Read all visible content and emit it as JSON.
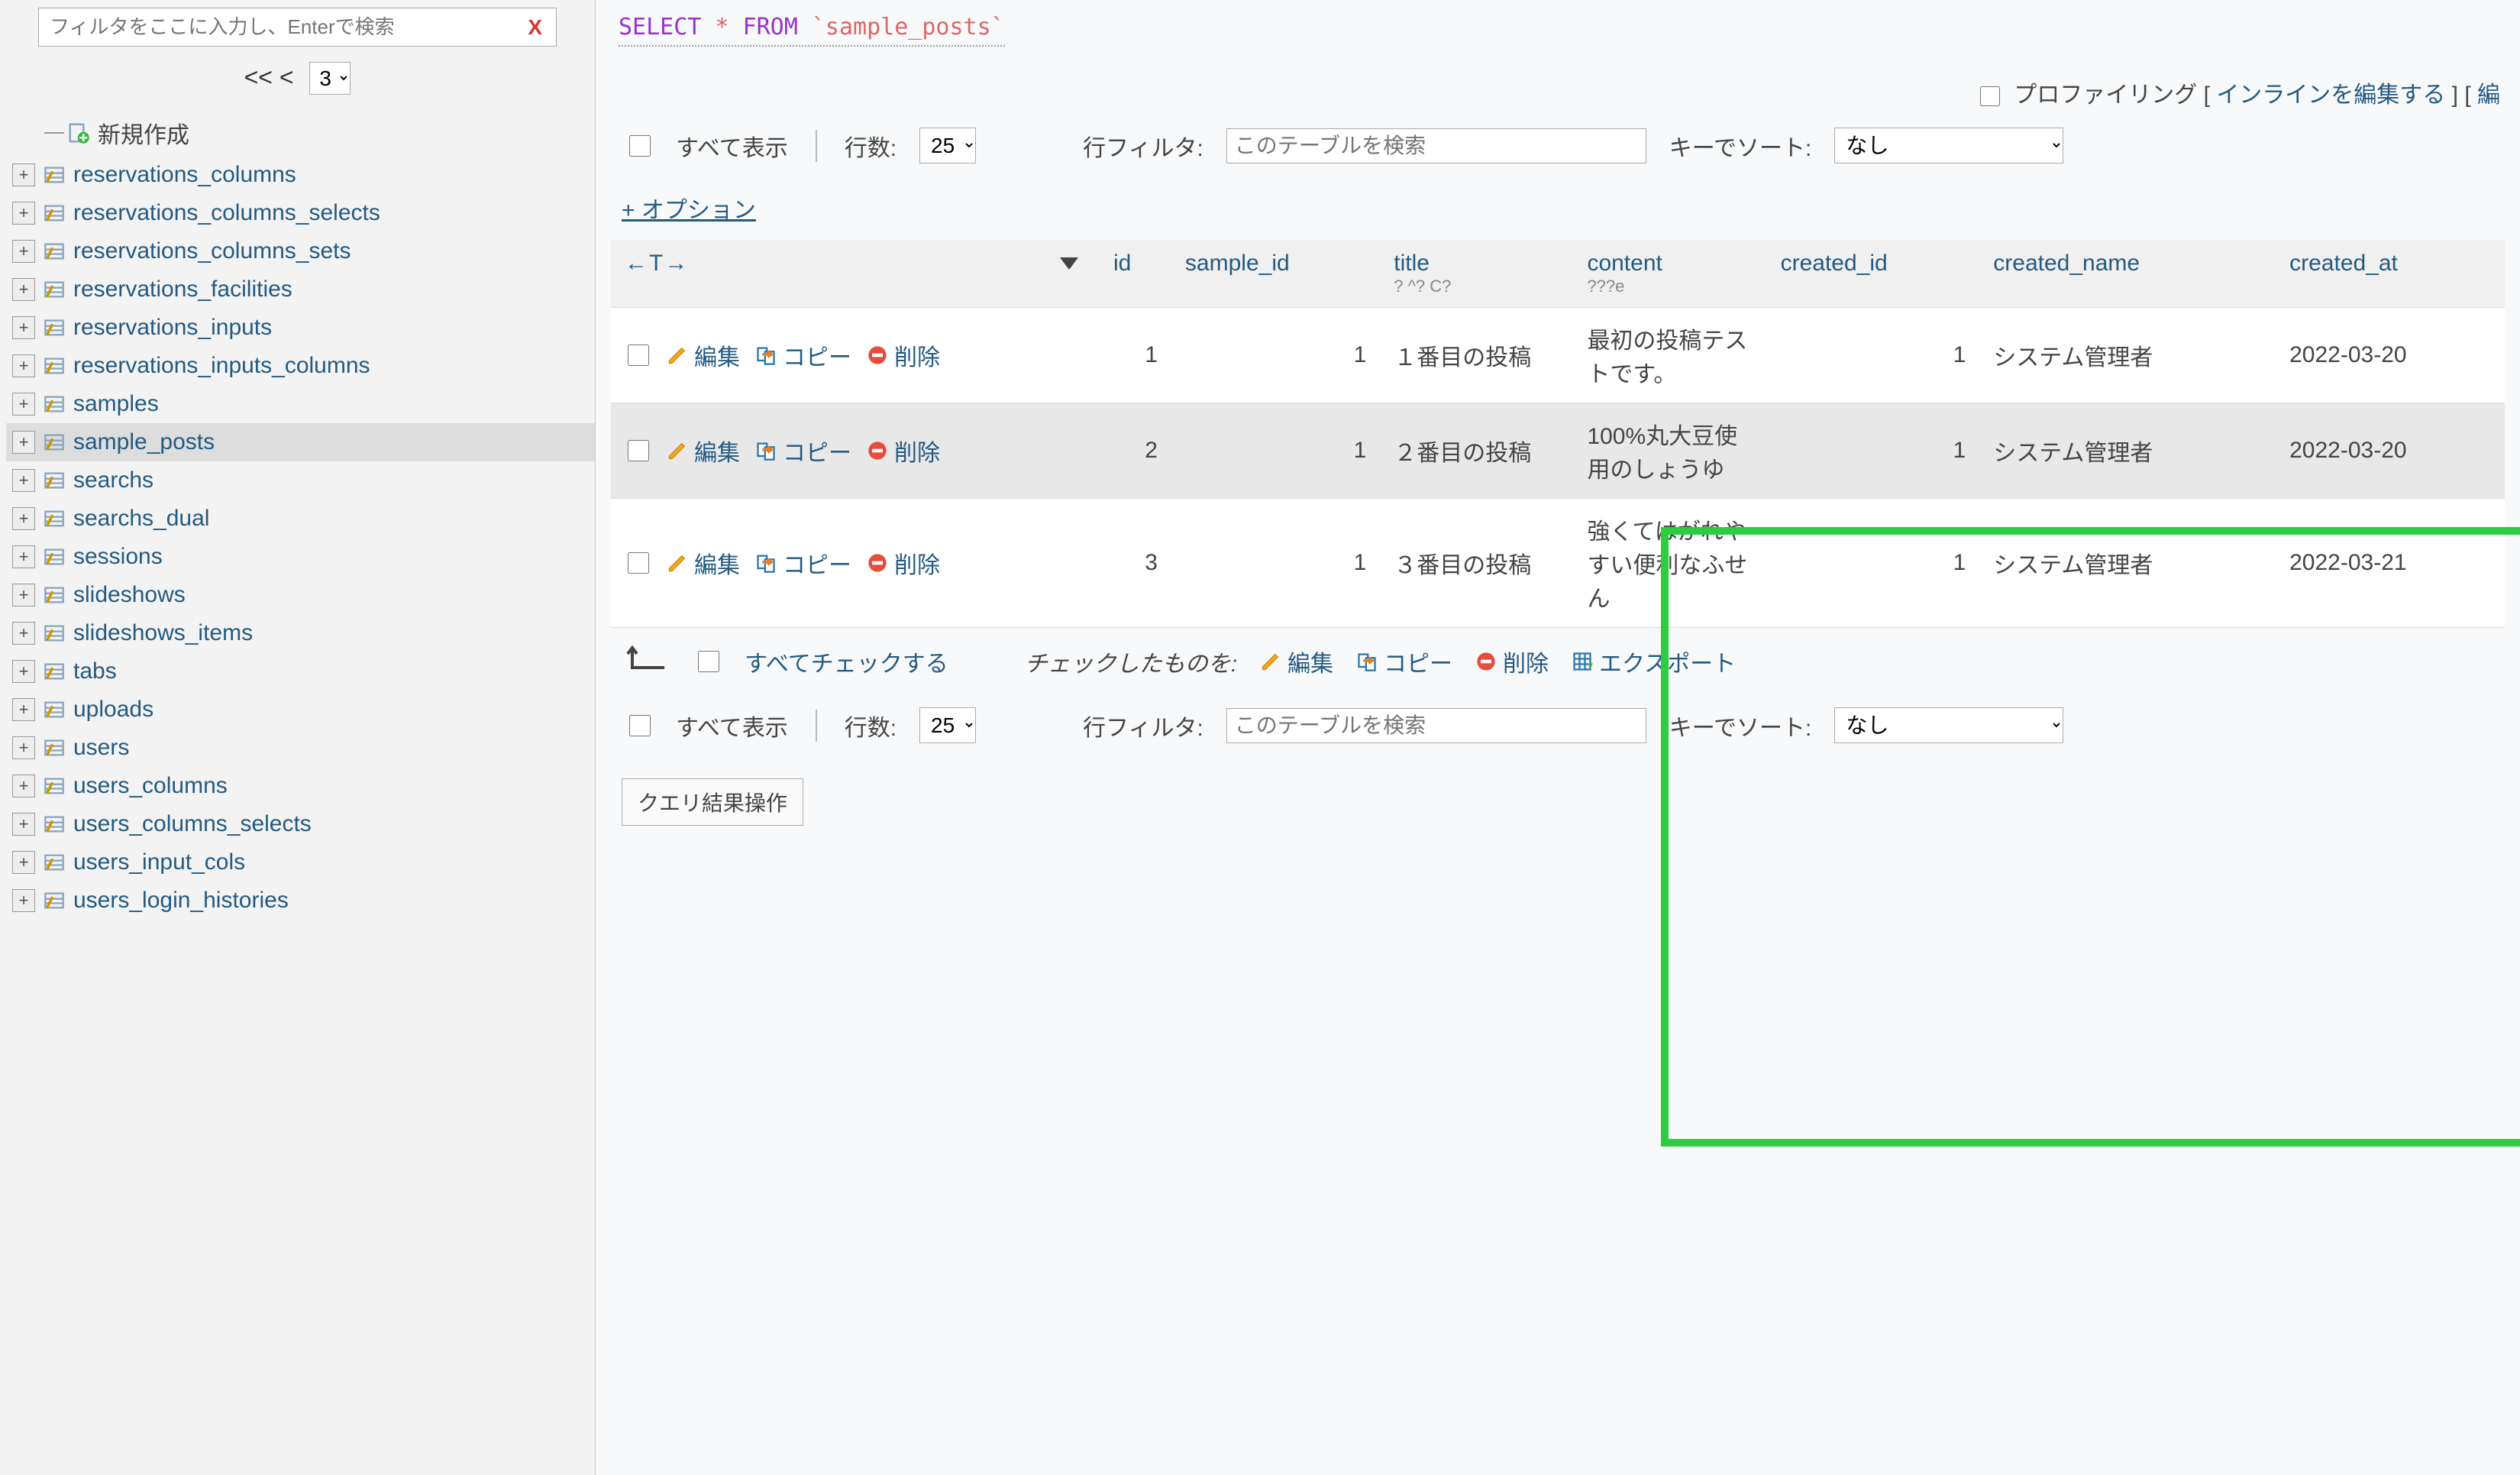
{
  "sidebar": {
    "filter_placeholder": "フィルタをここに入力し、Enterで検索",
    "nav_arrows": "<< <",
    "page_select": "3",
    "new_label": "新規作成",
    "tables": [
      "reservations_columns",
      "reservations_columns_selects",
      "reservations_columns_sets",
      "reservations_facilities",
      "reservations_inputs",
      "reservations_inputs_columns",
      "samples",
      "sample_posts",
      "searchs",
      "searchs_dual",
      "sessions",
      "slideshows",
      "slideshows_items",
      "tabs",
      "uploads",
      "users",
      "users_columns",
      "users_columns_selects",
      "users_input_cols",
      "users_login_histories"
    ],
    "active_table": "sample_posts"
  },
  "sql": {
    "select": "SELECT",
    "star": "*",
    "from": "FROM",
    "table": "`sample_posts`"
  },
  "profiling": {
    "label": "プロファイリング",
    "inline_edit": "インラインを編集する",
    "bracket_open": "[",
    "bracket_close": "] [ ",
    "trailing": "編"
  },
  "controls": {
    "show_all": "すべて表示",
    "rows_label": "行数:",
    "rows_value": "25",
    "filter_label": "行フィルタ:",
    "filter_placeholder": "このテーブルを検索",
    "sort_label": "キーでソート:",
    "sort_value": "なし"
  },
  "options_link": "+ オプション",
  "headers": {
    "arrows": "←T→",
    "id": "id",
    "sample_id": "sample_id",
    "title": "title",
    "title_sub": "?\n^?\nC?",
    "content": "content",
    "content_sub": "???e",
    "created_id": "created_id",
    "created_name": "created_name",
    "created_at": "created_at"
  },
  "row_actions": {
    "edit": "編集",
    "copy": "コピー",
    "delete": "削除"
  },
  "rows": [
    {
      "id": "1",
      "sample_id": "1",
      "title": "１番目の投稿",
      "content": "最初の投稿テストです。",
      "created_id": "1",
      "created_name": "システム管理者",
      "created_at": "2022-03-20"
    },
    {
      "id": "2",
      "sample_id": "1",
      "title": "２番目の投稿",
      "content": "100%丸大豆使用のしょうゆ",
      "created_id": "1",
      "created_name": "システム管理者",
      "created_at": "2022-03-20"
    },
    {
      "id": "3",
      "sample_id": "1",
      "title": "３番目の投稿",
      "content": "強くてはがれやすい便利なふせん",
      "created_id": "1",
      "created_name": "システム管理者",
      "created_at": "2022-03-21"
    }
  ],
  "bulk": {
    "check_all": "すべてチェックする",
    "with_checked": "チェックしたものを:",
    "edit": "編集",
    "copy": "コピー",
    "delete": "削除",
    "export": "エクスポート"
  },
  "query_ops_btn": "クエリ結果操作"
}
